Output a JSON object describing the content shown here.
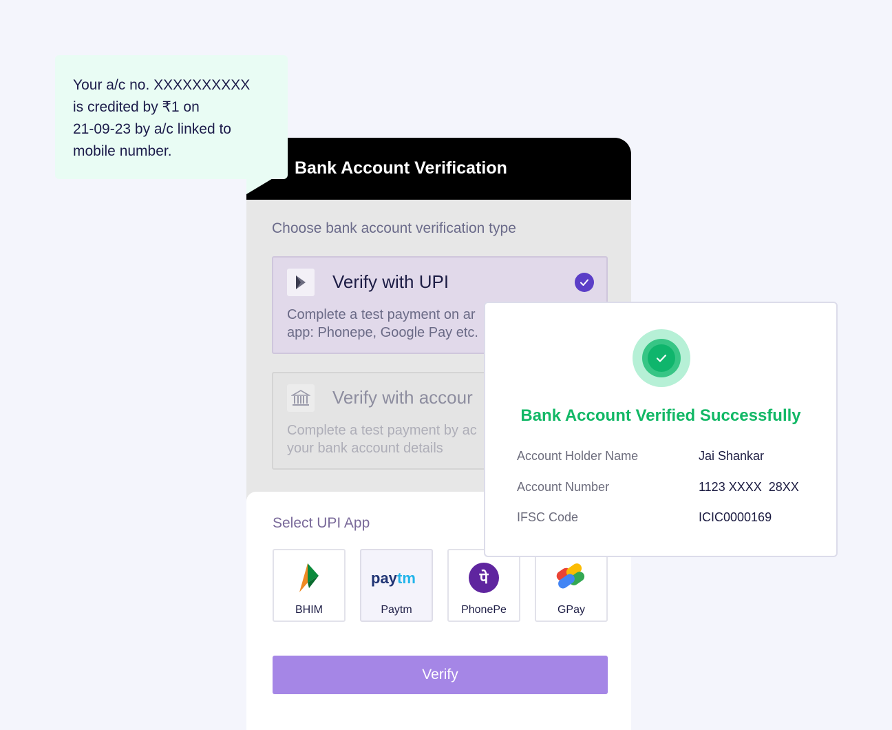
{
  "sms": {
    "lines": [
      "Your a/c no. XXXXXXXXXX",
      "is credited by ₹1 on",
      "21-09-23 by a/c linked to",
      "mobile number."
    ]
  },
  "card": {
    "title": "Bank Account Verification",
    "choose_label": "Choose bank account verification type",
    "options": [
      {
        "title": "Verify with UPI",
        "desc_line1": "Complete a test payment on ar",
        "desc_line2": "app: Phonepe, Google Pay etc.",
        "icon": "upi-icon",
        "selected": true
      },
      {
        "title": "Verify with accour",
        "desc_line1": "Complete a test payment by ac",
        "desc_line2": "your bank account details",
        "icon": "bank-icon",
        "selected": false
      }
    ],
    "upi_label": "Select UPI App",
    "apps": [
      {
        "name": "BHIM",
        "icon": "bhim-logo"
      },
      {
        "name": "Paytm",
        "icon": "paytm-logo"
      },
      {
        "name": "PhonePe",
        "icon": "phonepe-logo"
      },
      {
        "name": "GPay",
        "icon": "gpay-logo"
      }
    ],
    "verify_label": "Verify"
  },
  "success": {
    "title": "Bank Account Verified Successfully",
    "rows": [
      {
        "label": "Account Holder Name",
        "value": "Jai Shankar"
      },
      {
        "label": "Account Number",
        "value": "1123 XXXX  28XX"
      },
      {
        "label": "IFSC Code",
        "value": "ICIC0000169"
      }
    ],
    "colors": {
      "accent": "#12b866",
      "brand": "#5b3ec7",
      "button": "#a586e6"
    }
  }
}
